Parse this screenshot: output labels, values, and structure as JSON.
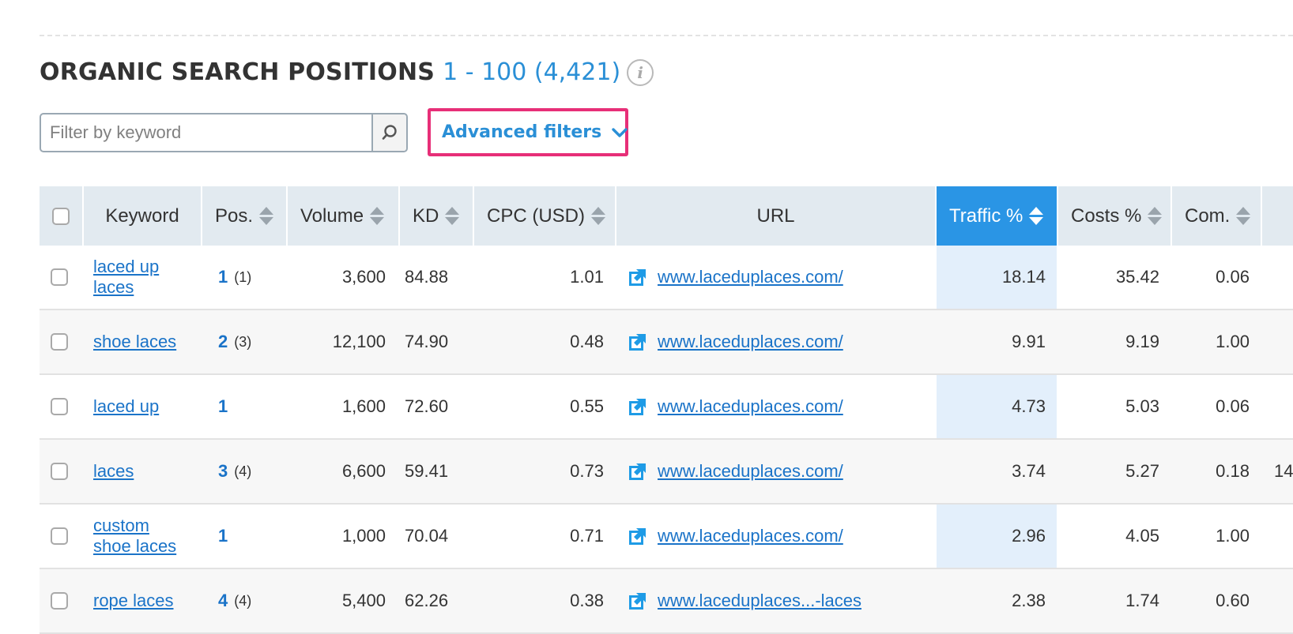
{
  "header": {
    "title": "ORGANIC SEARCH POSITIONS",
    "range": "1 - 100 (4,421)",
    "info_symbol": "i"
  },
  "filter": {
    "placeholder": "Filter by keyword",
    "advanced_label": "Advanced filters"
  },
  "columns": [
    "Keyword",
    "Pos.",
    "Volume",
    "KD",
    "CPC (USD)",
    "URL",
    "Traffic %",
    "Costs %",
    "Com."
  ],
  "rows": [
    {
      "keyword": "laced up laces",
      "pos": "1",
      "prev": "(1)",
      "volume": "3,600",
      "kd": "84.88",
      "cpc": "1.01",
      "url": "www.laceduplaces.com/",
      "traffic": "18.14",
      "costs": "35.42",
      "com": "0.06",
      "extra": ""
    },
    {
      "keyword": "shoe laces",
      "pos": "2",
      "prev": "(3)",
      "volume": "12,100",
      "kd": "74.90",
      "cpc": "0.48",
      "url": "www.laceduplaces.com/",
      "traffic": "9.91",
      "costs": "9.19",
      "com": "1.00",
      "extra": ""
    },
    {
      "keyword": "laced up",
      "pos": "1",
      "prev": "",
      "volume": "1,600",
      "kd": "72.60",
      "cpc": "0.55",
      "url": "www.laceduplaces.com/",
      "traffic": "4.73",
      "costs": "5.03",
      "com": "0.06",
      "extra": ""
    },
    {
      "keyword": "laces",
      "pos": "3",
      "prev": "(4)",
      "volume": "6,600",
      "kd": "59.41",
      "cpc": "0.73",
      "url": "www.laceduplaces.com/",
      "traffic": "3.74",
      "costs": "5.27",
      "com": "0.18",
      "extra": "14"
    },
    {
      "keyword": "custom shoe laces",
      "pos": "1",
      "prev": "",
      "volume": "1,000",
      "kd": "70.04",
      "cpc": "0.71",
      "url": "www.laceduplaces.com/",
      "traffic": "2.96",
      "costs": "4.05",
      "com": "1.00",
      "extra": ""
    },
    {
      "keyword": "rope laces",
      "pos": "4",
      "prev": "(4)",
      "volume": "5,400",
      "kd": "62.26",
      "cpc": "0.38",
      "url": "www.laceduplaces...-laces",
      "traffic": "2.38",
      "costs": "1.74",
      "com": "0.60",
      "extra": ""
    }
  ],
  "colors": {
    "accent": "#2a8fd6",
    "highlight_border": "#e72f78",
    "header_bg": "#e2eaf0",
    "active_header_bg": "#2a95e5"
  },
  "icons": {
    "search": "search-icon",
    "chevron": "chevron-down-icon",
    "external_link": "external-link-icon",
    "info": "info-icon"
  }
}
